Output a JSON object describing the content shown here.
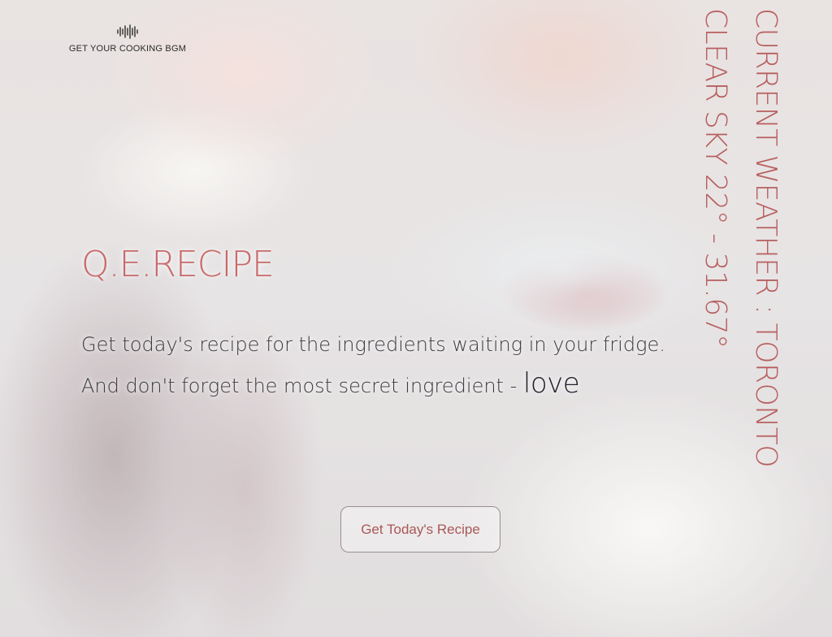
{
  "music": {
    "icon": "sound-wave-icon",
    "label": "GET YOUR COOKING BGM"
  },
  "hero": {
    "title": "Q.E.RECIPE",
    "tagline_line1": "Get today's recipe for the ingredients waiting in your fridge.",
    "tagline_line2_prefix": "And don't forget the most secret ingredient - ",
    "tagline_line2_emphasis": "love"
  },
  "weather": {
    "city_line": "CURRENT WEATHER : TORONTO",
    "temp_line": "CLEAR SKY 22° - 31.67°"
  },
  "cta": {
    "label": "Get Today's Recipe"
  },
  "colors": {
    "accent": "#c86a6a",
    "weather_text": "#b75f5f",
    "body_text": "#3b3b40"
  }
}
